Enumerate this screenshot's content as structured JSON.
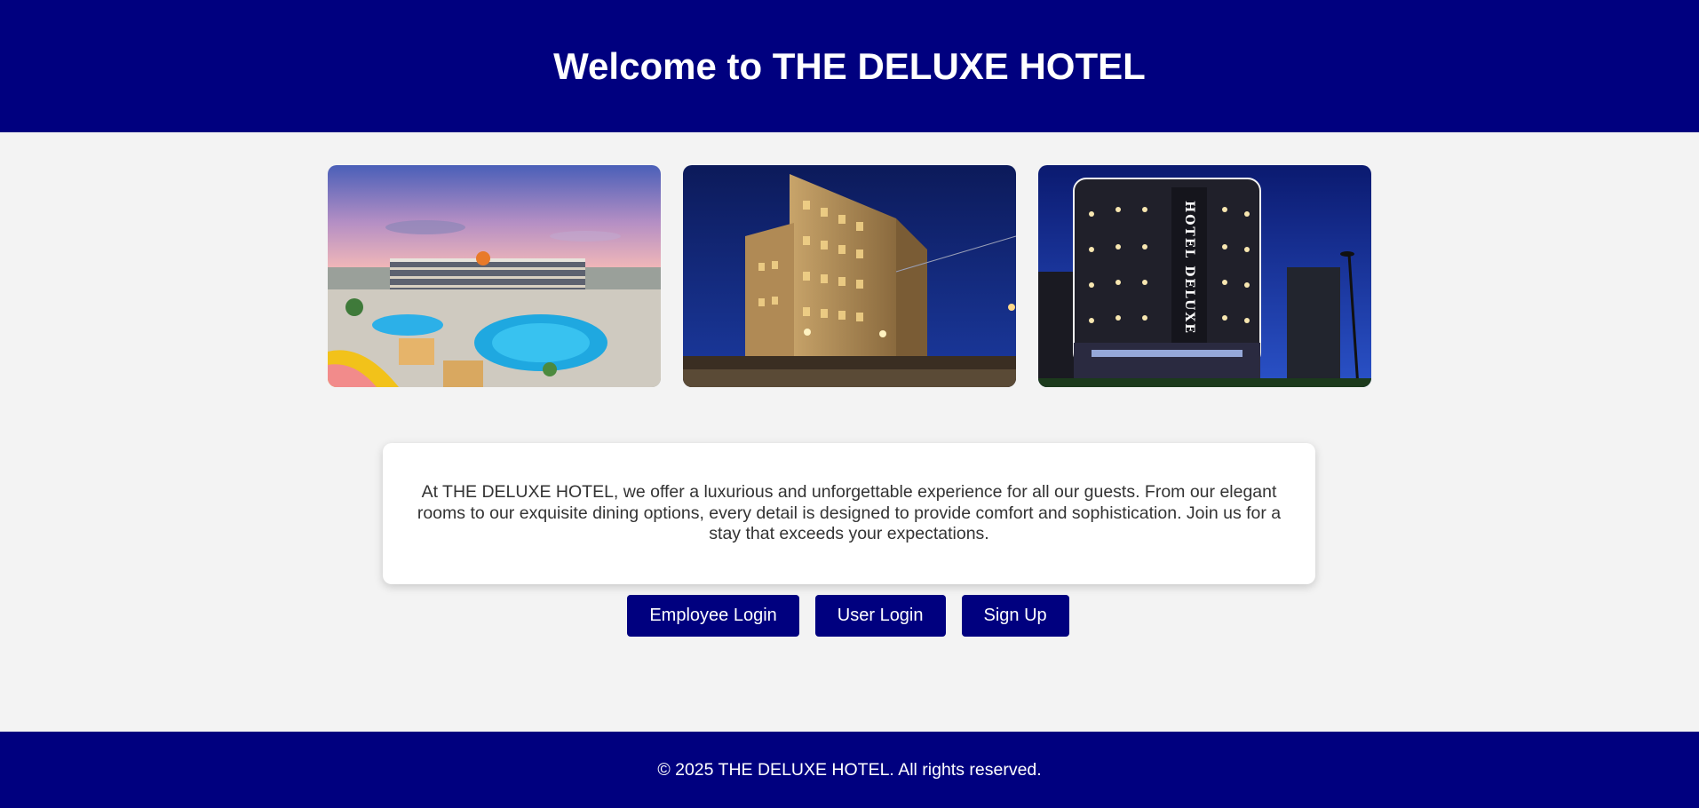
{
  "header": {
    "title": "Welcome to THE DELUXE HOTEL"
  },
  "gallery": {
    "images": [
      {
        "name": "resort-pool-photo",
        "alt": "Resort with pools and water slides"
      },
      {
        "name": "historic-hotel-photo",
        "alt": "Historic hotel building at night"
      },
      {
        "name": "hotel-deluxe-night-photo",
        "alt": "Hotel Deluxe lit at night",
        "sign_text": "HOTEL DELUXE"
      }
    ]
  },
  "intro": {
    "text": "At THE DELUXE HOTEL, we offer a luxurious and unforgettable experience for all our guests. From our elegant rooms to our exquisite dining options, every detail is designed to provide comfort and sophistication. Join us for a stay that exceeds your expectations."
  },
  "actions": {
    "employee_login": "Employee Login",
    "user_login": "User Login",
    "sign_up": "Sign Up"
  },
  "footer": {
    "copyright": "© 2025 THE DELUXE HOTEL. All rights reserved."
  },
  "colors": {
    "brand": "#00007f",
    "background": "#f3f3f3",
    "card": "#ffffff",
    "text": "#333333"
  }
}
